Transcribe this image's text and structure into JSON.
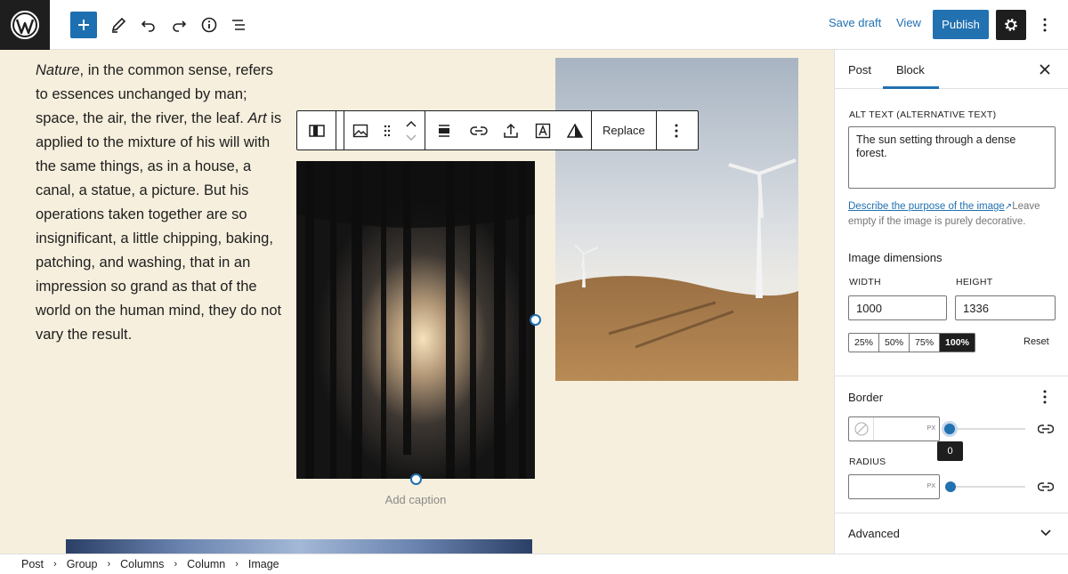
{
  "topbar": {
    "save_draft": "Save draft",
    "view": "View",
    "publish": "Publish"
  },
  "content": {
    "paragraph": {
      "w1": "Nature",
      "t1": ", in the common sense, refers to essences unchanged by man; space, the air, the river, the leaf. ",
      "w2": "Art",
      "t2": " is applied to the mixture of his will with the same things, as in a house, a canal, a statue, a picture. But his operations taken together are so insignificant, a little chipping, baking, patching, and washing, that in an impression so grand as that of the world on the human mind, they do not vary the result."
    },
    "caption_placeholder": "Add caption"
  },
  "block_toolbar": {
    "replace": "Replace"
  },
  "sidebar": {
    "tabs": [
      "Post",
      "Block"
    ],
    "active_tab": "Block",
    "alt_label": "ALT TEXT (ALTERNATIVE TEXT)",
    "alt_value": "The sun setting through a dense forest.",
    "alt_help_link": "Describe the purpose of the image",
    "alt_help_rest": "Leave empty if the image is purely decorative.",
    "dimensions_title": "Image dimensions",
    "width_label": "WIDTH",
    "height_label": "HEIGHT",
    "width_value": "1000",
    "height_value": "1336",
    "percents": [
      "25%",
      "50%",
      "75%",
      "100%"
    ],
    "active_percent": "100%",
    "reset": "Reset",
    "border_title": "Border",
    "border_unit": "PX",
    "border_tooltip": "0",
    "radius_label": "RADIUS",
    "radius_unit": "PX",
    "advanced": "Advanced"
  },
  "breadcrumb": [
    "Post",
    "Group",
    "Columns",
    "Column",
    "Image"
  ],
  "colors": {
    "accent": "#2271b1",
    "canvas_bg": "#f6efdd",
    "dark": "#1e1e1e"
  }
}
